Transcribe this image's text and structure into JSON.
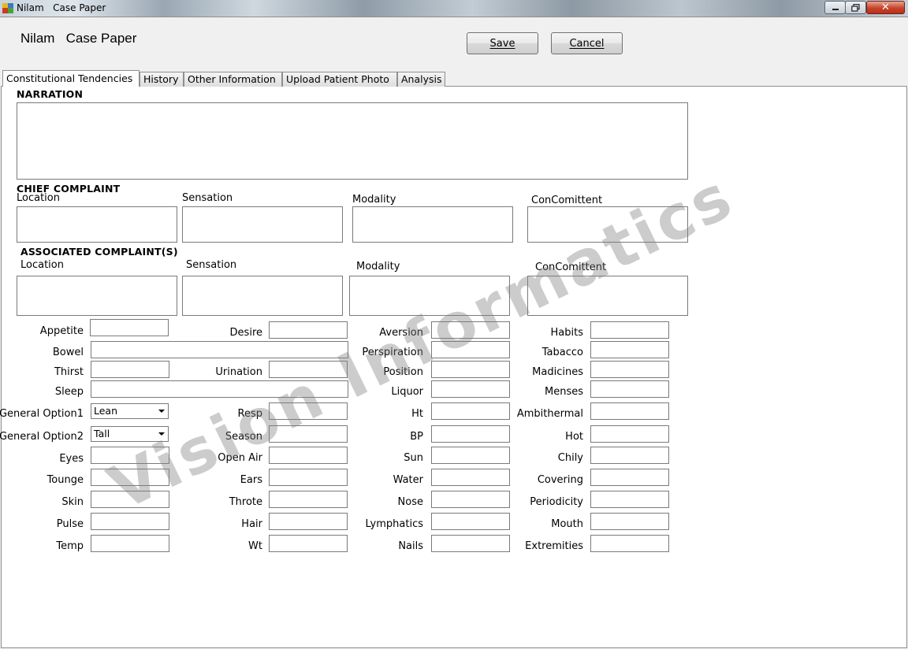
{
  "window": {
    "title": "Nilam   Case Paper"
  },
  "header": {
    "heading": "Nilam   Case Paper",
    "save_label": "Save",
    "cancel_label": "Cancel"
  },
  "tabs": [
    {
      "label": "Constitutional Tendencies",
      "active": true
    },
    {
      "label": "History",
      "active": false
    },
    {
      "label": "Other Information",
      "active": false
    },
    {
      "label": "Upload Patient Photo",
      "active": false
    },
    {
      "label": "Analysis",
      "active": false
    }
  ],
  "narration": {
    "heading": "NARRATION"
  },
  "chief_complaint": {
    "heading": "CHIEF COMPLAINT",
    "location": "Location",
    "sensation": "Sensation",
    "modality": "Modality",
    "concomittent": "ConComittent"
  },
  "associated_complaints": {
    "heading": "ASSOCIATED COMPLAINT(S)",
    "location": "Location",
    "sensation": "Sensation",
    "modality": "Modality",
    "concomittent": "ConComittent"
  },
  "fields": {
    "appetite": "Appetite",
    "bowel": "Bowel",
    "thirst": "Thirst",
    "sleep": "Sleep",
    "general_option1": "General Option1",
    "general_option2": "General Option2",
    "eyes": "Eyes",
    "tounge": "Tounge",
    "skin": "Skin",
    "pulse": "Pulse",
    "temp": "Temp",
    "desire": "Desire",
    "urination": "Urination",
    "resp": "Resp",
    "season": "Season",
    "open_air": "Open Air",
    "ears": "Ears",
    "throte": "Throte",
    "hair": "Hair",
    "wt": "Wt",
    "aversion": "Aversion",
    "perspiration": "Perspiration",
    "position": "Position",
    "liquor": "Liquor",
    "ht": "Ht",
    "bp": "BP",
    "sun": "Sun",
    "water": "Water",
    "nose": "Nose",
    "lymphatics": "Lymphatics",
    "nails": "Nails",
    "habits": "Habits",
    "tabacco": "Tabacco",
    "madicines": "Madicines",
    "menses": "Menses",
    "ambithermal": "Ambithermal",
    "hot": "Hot",
    "chily": "Chily",
    "covering": "Covering",
    "periodicity": "Periodicity",
    "mouth": "Mouth",
    "extremities": "Extremities"
  },
  "selects": {
    "general_option1_value": "Lean",
    "general_option2_value": "Tall"
  },
  "watermark": {
    "text": "Vision Informatics"
  },
  "colors": {
    "close_button": "#c7442c",
    "panel_background": "#ffffff",
    "window_background": "#f0f0f0"
  }
}
